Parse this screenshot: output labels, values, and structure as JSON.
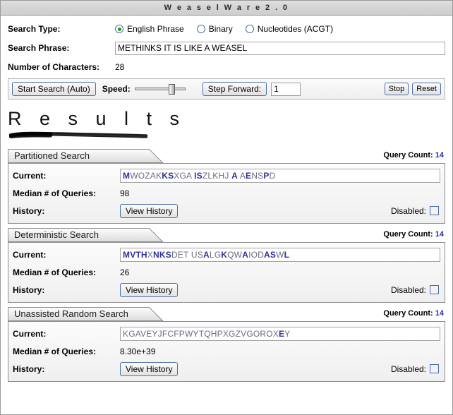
{
  "window": {
    "title": "W e a s e l   W a r e   2 . 0"
  },
  "search_form": {
    "search_type_label": "Search Type:",
    "options": [
      {
        "label": "English Phrase",
        "selected": true
      },
      {
        "label": "Binary",
        "selected": false
      },
      {
        "label": "Nucleotides (ACGT)",
        "selected": false
      }
    ],
    "search_phrase_label": "Search Phrase:",
    "search_phrase_value": "METHINKS IT IS LIKE A WEASEL",
    "search_phrase_placeholder": "",
    "num_chars_label": "Number of Characters:",
    "num_chars_value": "28"
  },
  "controls": {
    "start_label": "Start Search (Auto)",
    "speed_label": "Speed:",
    "step_label": "Step Forward:",
    "step_value": "1",
    "stop_label": "Stop",
    "reset_label": "Reset"
  },
  "results": {
    "heading": "R e s u l t s"
  },
  "labels": {
    "current": "Current:",
    "median": "Median # of Queries:",
    "history": "History:",
    "view_history": "View History",
    "disabled": "Disabled:",
    "query_count": "Query Count:"
  },
  "panels": [
    {
      "title": "Partitioned Search",
      "query_count": "14",
      "current_html": "<b>M</b>WOZAK<b>KS</b>XGA <b>IS</b>ZLKHJ <b>A</b> A<b>E</b>NS<b>P</b>D",
      "median": "98",
      "disabled_checked": false
    },
    {
      "title": "Deterministic Search",
      "query_count": "14",
      "current_html": "<b>MVTH</b>X<b>NKS</b>DET US<b>A</b>LG<b>K</b>QW<b>A</b>IOD<b>AS</b>W<b>L</b>",
      "median": "26",
      "disabled_checked": false
    },
    {
      "title": "Unassisted Random Search",
      "query_count": "14",
      "current_html": "KGAVEYJFCFPWYTQHPXGZVGOROX<b>E</b>Y",
      "median": "8.30e+39",
      "disabled_checked": false
    }
  ],
  "colors": {
    "accent_blue": "#2b2bbd",
    "radio_green": "#1a9c1a",
    "control_border": "#4a6fa5"
  }
}
